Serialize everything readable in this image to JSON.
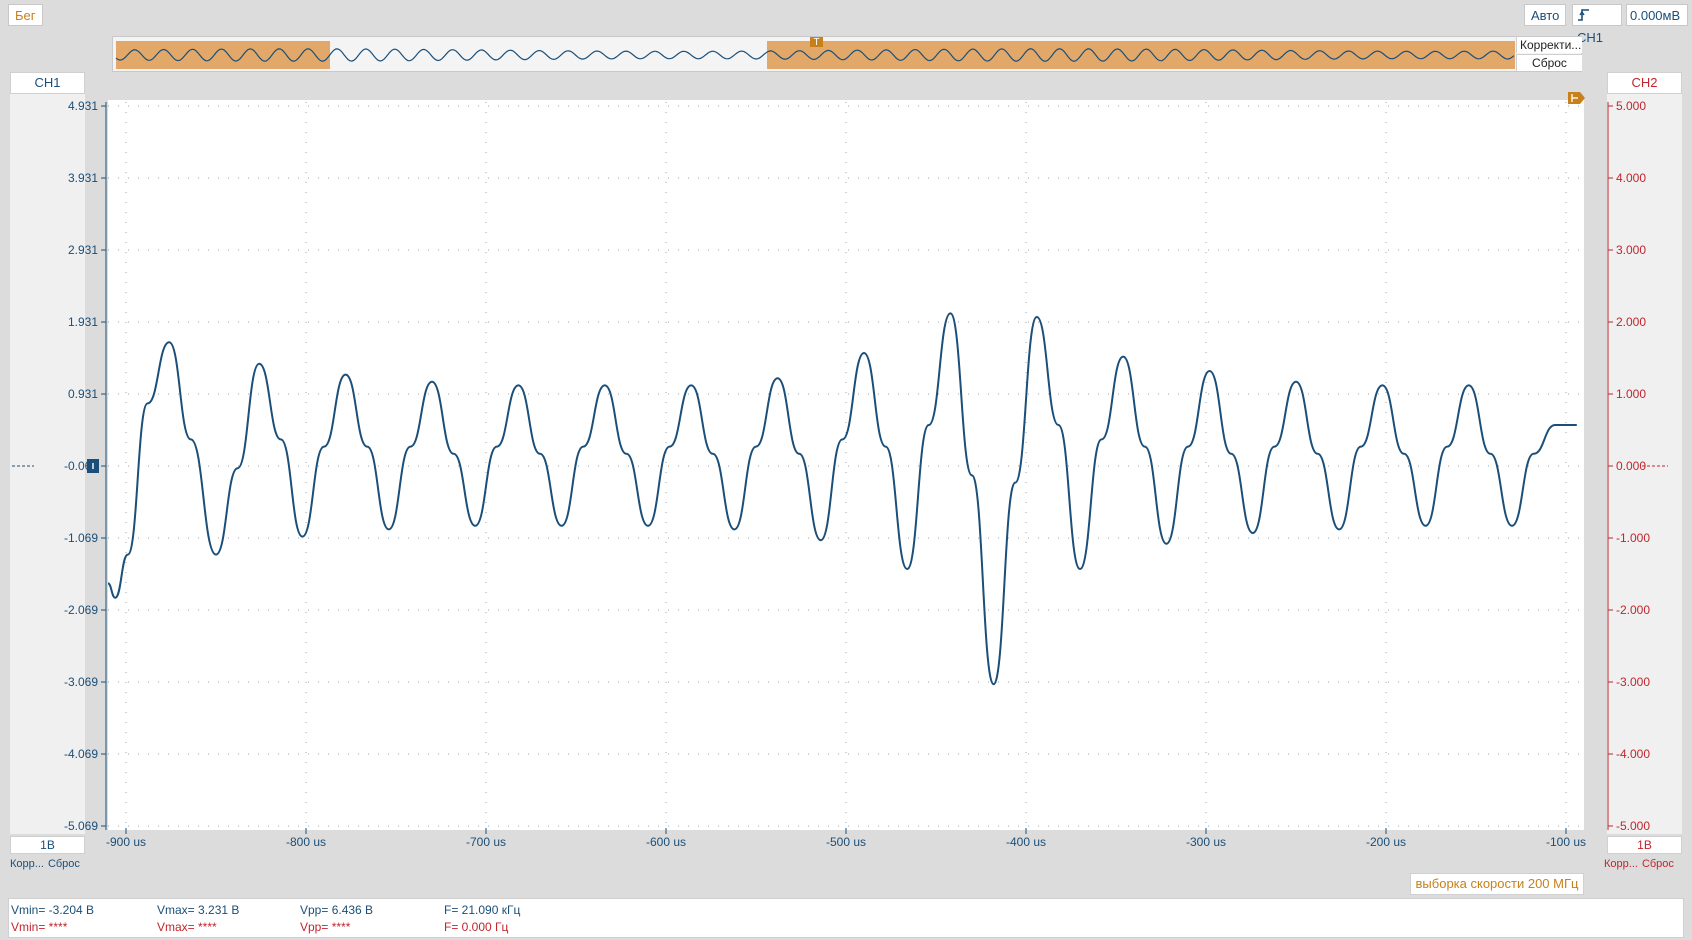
{
  "toolbar": {
    "run_label": "Бег",
    "auto_label": "Авто",
    "trigger_channel": "CH1",
    "trigger_level": "0.000мВ"
  },
  "overview": {
    "fit_label": "Корректи...",
    "reset_label": "Сброс",
    "trigger_marker": "T",
    "highlight_color": "#e2a869"
  },
  "channels": {
    "ch1": {
      "name": "CH1",
      "color": "#1b4f79",
      "scale": "1B",
      "fit_label": "Корр...",
      "reset_label": "Сброс",
      "ticks": [
        "4.931",
        "3.931",
        "2.931",
        "1.931",
        "0.931",
        "-0.069",
        "-1.069",
        "-2.069",
        "-3.069",
        "-4.069",
        "-5.069"
      ]
    },
    "ch2": {
      "name": "CH2",
      "color": "#c0262d",
      "scale": "1B",
      "fit_label": "Корр...",
      "reset_label": "Сброс",
      "ticks": [
        "5.000",
        "4.000",
        "3.000",
        "2.000",
        "1.000",
        "0.000",
        "-1.000",
        "-2.000",
        "-3.000",
        "-4.000",
        "-5.000"
      ]
    }
  },
  "time_axis": {
    "ticks": [
      "-900 us",
      "-800 us",
      "-700 us",
      "-600 us",
      "-500 us",
      "-400 us",
      "-300 us",
      "-200 us",
      "-100 us"
    ]
  },
  "sample_rate_label": "выборка скорости 200 МГц",
  "measurements": {
    "ch1": {
      "vmin": "Vmin= -3.204 B",
      "vmax": "Vmax= 3.231 B",
      "vpp": "Vpp= 6.436 B",
      "freq": "F= 21.090 кГц"
    },
    "ch2": {
      "vmin": "Vmin= ****",
      "vmax": "Vmax= ****",
      "vpp": "Vpp= ****",
      "freq": "F= 0.000 Гц"
    }
  },
  "chart_data": {
    "type": "line",
    "xlabel": "",
    "ylabel": "",
    "xlim": [
      -910,
      -90
    ],
    "ylim": [
      -5.069,
      4.931
    ],
    "grid": true,
    "series": [
      {
        "channel": "CH1",
        "x": [
          -910,
          -906,
          -899,
          -888,
          -876,
          -864,
          -850,
          -838,
          -826,
          -814,
          -802,
          -790,
          -778,
          -766,
          -754,
          -742,
          -730,
          -718,
          -706,
          -694,
          -682,
          -670,
          -658,
          -646,
          -634,
          -622,
          -610,
          -598,
          -586,
          -574,
          -562,
          -550,
          -538,
          -526,
          -514,
          -502,
          -490,
          -478,
          -466,
          -454,
          -442,
          -430,
          -418,
          -406,
          -394,
          -382,
          -370,
          -358,
          -346,
          -334,
          -322,
          -310,
          -298,
          -286,
          -274,
          -262,
          -250,
          -238,
          -226,
          -214,
          -202,
          -190,
          -178,
          -166,
          -154,
          -142,
          -130,
          -118,
          -106,
          -94
        ],
        "y": [
          -1.7,
          -1.9,
          -1.3,
          0.8,
          1.65,
          0.3,
          -1.3,
          -0.1,
          1.35,
          0.3,
          -1.05,
          0.2,
          1.2,
          0.2,
          -0.95,
          0.2,
          1.1,
          0.1,
          -0.9,
          0.2,
          1.05,
          0.1,
          -0.9,
          0.2,
          1.05,
          0.1,
          -0.9,
          0.2,
          1.05,
          0.1,
          -0.95,
          0.2,
          1.15,
          0.1,
          -1.1,
          0.3,
          1.5,
          0.2,
          -1.5,
          0.5,
          2.05,
          -0.2,
          -3.1,
          -0.3,
          2.0,
          0.5,
          -1.5,
          0.3,
          1.45,
          0.2,
          -1.15,
          0.2,
          1.25,
          0.1,
          -1.0,
          0.2,
          1.1,
          0.1,
          -0.95,
          0.2,
          1.05,
          0.1,
          -0.9,
          0.2,
          1.05,
          0.1,
          -0.9,
          0.1,
          0.5,
          0.5
        ]
      }
    ]
  }
}
